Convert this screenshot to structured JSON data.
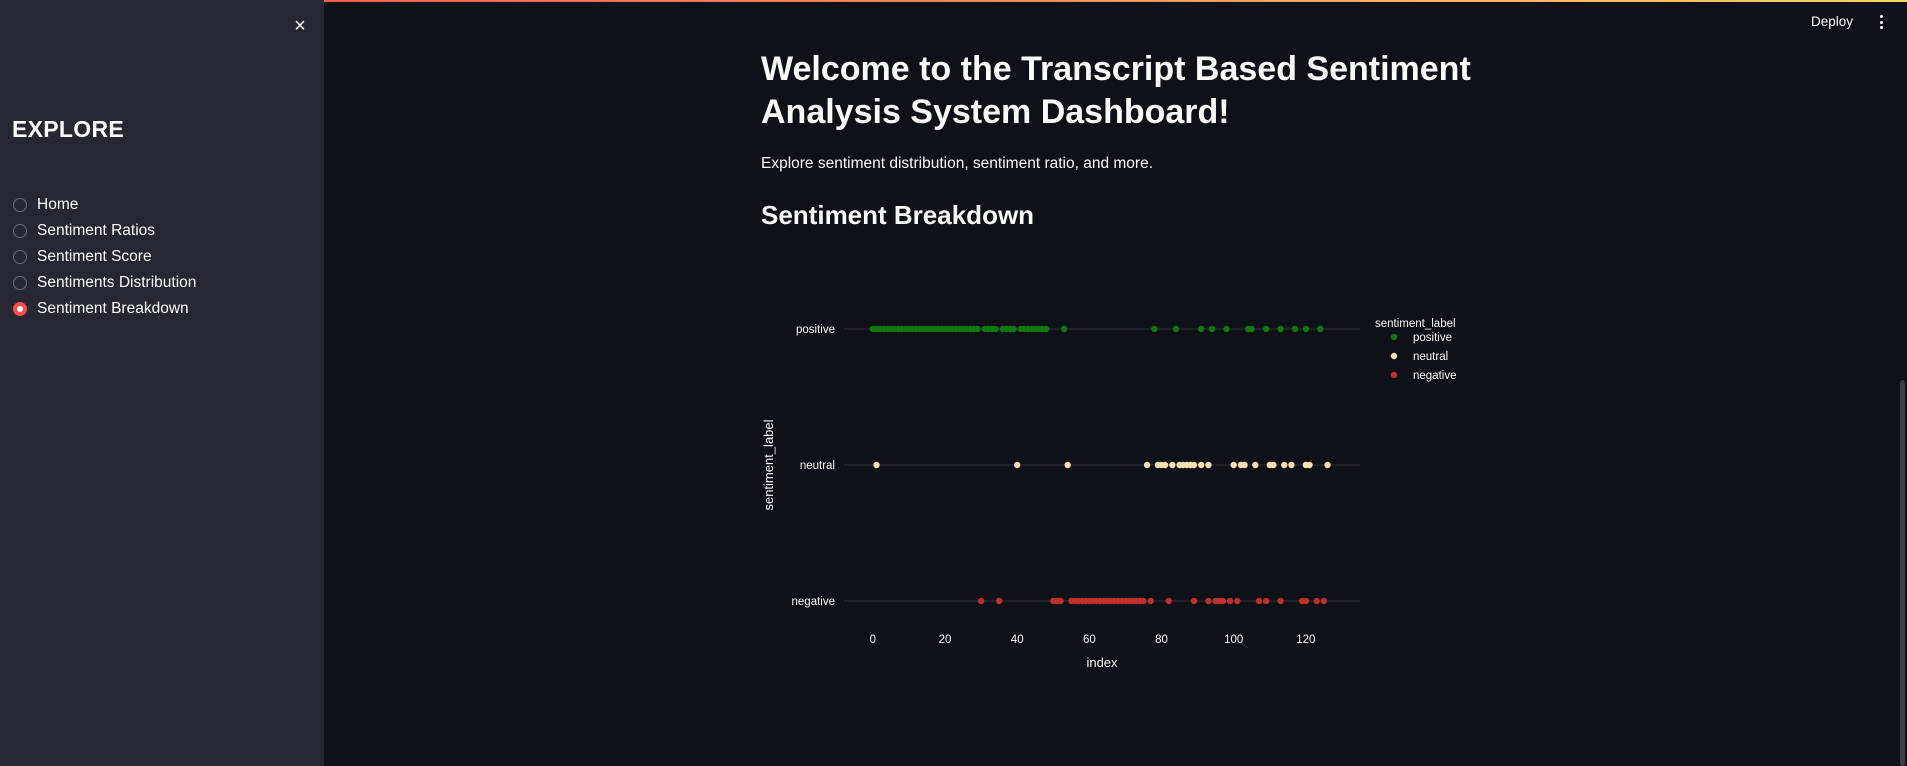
{
  "sidebar": {
    "close_icon": "×",
    "title": "EXPLORE",
    "items": [
      {
        "label": "Home",
        "selected": false
      },
      {
        "label": "Sentiment Ratios",
        "selected": false
      },
      {
        "label": "Sentiment Score",
        "selected": false
      },
      {
        "label": "Sentiments Distribution",
        "selected": false
      },
      {
        "label": "Sentiment Breakdown",
        "selected": true
      }
    ]
  },
  "header": {
    "deploy_label": "Deploy",
    "menu_icon": "kebab-menu-icon"
  },
  "main": {
    "title": "Welcome to the Transcript Based Sentiment Analysis System Dashboard!",
    "subtitle": "Explore sentiment distribution, sentiment ratio, and more.",
    "section_title": "Sentiment Breakdown"
  },
  "colors": {
    "accent": "#ff4b4b",
    "positive": "#0e7a0d",
    "neutral": "#ffe0b0",
    "negative": "#c0302b"
  },
  "chart_data": {
    "type": "scatter",
    "xlabel": "index",
    "ylabel": "sentiment_label",
    "xlim": [
      -8,
      135
    ],
    "xticks": [
      0,
      20,
      40,
      60,
      80,
      100,
      120
    ],
    "categories": [
      "positive",
      "neutral",
      "negative"
    ],
    "legend": {
      "title": "sentiment_label",
      "placement": "top-right",
      "entries": [
        "positive",
        "neutral",
        "negative"
      ]
    },
    "series": [
      {
        "name": "positive",
        "color": "#0e7a0d",
        "x": [
          0,
          1,
          2,
          3,
          4,
          5,
          6,
          7,
          8,
          9,
          10,
          11,
          12,
          13,
          14,
          15,
          16,
          17,
          18,
          19,
          20,
          21,
          22,
          23,
          24,
          25,
          26,
          27,
          28,
          29,
          31,
          32,
          33,
          34,
          36,
          37,
          38,
          39,
          41,
          42,
          43,
          44,
          45,
          46,
          47,
          48,
          53,
          78,
          84,
          91,
          94,
          98,
          104,
          105,
          109,
          113,
          117,
          120,
          124
        ]
      },
      {
        "name": "neutral",
        "color": "#ffe0b0",
        "x": [
          1,
          40,
          54,
          76,
          79,
          80,
          81,
          83,
          85,
          86,
          87,
          88,
          89,
          91,
          93,
          100,
          102,
          103,
          106,
          110,
          111,
          114,
          116,
          120,
          121,
          126
        ]
      },
      {
        "name": "negative",
        "color": "#c0302b",
        "x": [
          30,
          35,
          50,
          51,
          52,
          55,
          56,
          57,
          58,
          59,
          60,
          61,
          62,
          63,
          64,
          65,
          66,
          67,
          68,
          69,
          70,
          71,
          72,
          73,
          74,
          75,
          77,
          82,
          89,
          93,
          95,
          96,
          97,
          99,
          101,
          107,
          109,
          113,
          119,
          120,
          123,
          125
        ]
      }
    ]
  }
}
